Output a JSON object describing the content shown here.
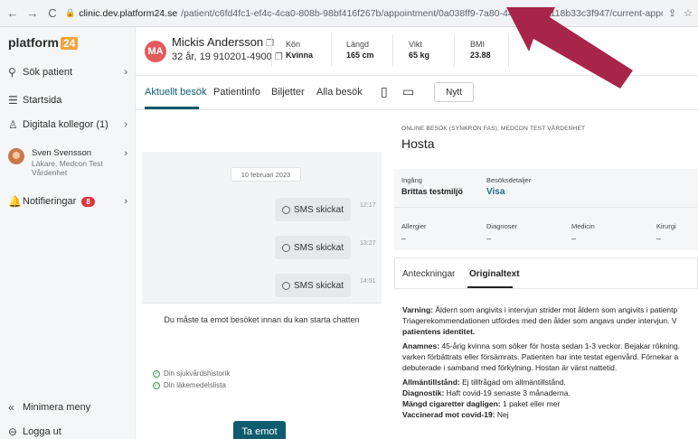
{
  "browser": {
    "back": "←",
    "forward": "→",
    "reload": "C",
    "url_host": "clinic.dev.platform24.se",
    "url_path": "/patient/c6fd4fc1-ef4c-4ca0-808b-98bf416f267b/appointment/0a038ff9-7a80-44cc-93a1-118b33c3f947/current-appointm..."
  },
  "sidebar": {
    "logo_text": "platform",
    "logo_num": "24",
    "items": [
      {
        "label": "Sök patient",
        "icon": "search-icon"
      },
      {
        "label": "Startsida",
        "icon": "list-icon"
      },
      {
        "label": "Digitala kollegor (1)",
        "icon": "people-icon"
      },
      {
        "label": "Notifieringar",
        "icon": "bell-icon",
        "badge": "8"
      }
    ],
    "user": {
      "name": "Sven Svensson",
      "role": "Läkare, Medcon Test Vårdenhet"
    },
    "minimize": "Minimera meny",
    "logout": "Logga ut"
  },
  "patient": {
    "initials": "MA",
    "name": "Mickis Andersson",
    "details": "32 år, 19 910201-4900",
    "stats": [
      {
        "label": "Kön",
        "value": "Kvinna"
      },
      {
        "label": "Längd",
        "value": "165 cm"
      },
      {
        "label": "Vikt",
        "value": "65 kg"
      },
      {
        "label": "BMI",
        "value": "23.88"
      }
    ]
  },
  "tabs": {
    "items": [
      "Aktuellt besök",
      "Patientinfo",
      "Biljetter",
      "Alla besök"
    ],
    "active": "Aktuellt besök",
    "new_button": "Nytt"
  },
  "chat": {
    "date": "10 februari 2023",
    "messages": [
      {
        "text": "SMS skickat",
        "time": "12:17"
      },
      {
        "text": "SMS skickat",
        "time": "13:27"
      },
      {
        "text": "SMS skickat",
        "time": "14:51"
      }
    ],
    "notice": "Du måste ta emot besöket innan du kan starta chatten",
    "checks": [
      "Din sjukvårdshistorik",
      "Din läkemedelslista"
    ],
    "accept_button": "Ta emot"
  },
  "visit": {
    "type": "ONLINE BESÖK (SYNKRON FAS), MEDCON TEST VÅRDENHET",
    "title": "Hosta",
    "ingang_label": "Ingång",
    "ingang_value": "Brittas testmiljö",
    "details_label": "Besöksdetaljer",
    "details_link": "Visa",
    "columns": [
      {
        "label": "Allergier",
        "value": "–"
      },
      {
        "label": "Diagnoser",
        "value": "–"
      },
      {
        "label": "Medicin",
        "value": "–"
      },
      {
        "label": "Kirurgi",
        "value": "–"
      }
    ],
    "note_tabs": [
      "Anteckningar",
      "Originaltext"
    ],
    "note_active": "Originaltext",
    "note_lines": [
      {
        "bold": "Varning:",
        "text": " Åldern som angivits i intervjun strider mot åldern som angivits i patientp"
      },
      {
        "bold": "",
        "text": "Triagerekommendationen utfördes med den ålder som angavs under intervjun. V"
      },
      {
        "bold": "patientens identitet.",
        "text": ""
      },
      {
        "bold": "Anamnes:",
        "text": " 45-årig kvinna som söker för hosta sedan 1-3 veckor. Bejakar rökning. "
      },
      {
        "bold": "",
        "text": "varken förbättrats eller försämrats. Patienten har inte testat egenvård. Förnekar a"
      },
      {
        "bold": "",
        "text": "debuterade i samband med förkylning. Hostan är värst nattetid."
      },
      {
        "bold": "Allmäntillstånd:",
        "text": " Ej tillfrågad om allmäntillstånd."
      },
      {
        "bold": "Diagnostik:",
        "text": " Haft covid-19 senaste 3 månaderna."
      },
      {
        "bold": "Mängd cigaretter dagligen:",
        "text": " 1 paket eller mer"
      },
      {
        "bold": "Vaccinerad mot covid-19:",
        "text": " Nej"
      }
    ]
  },
  "colors": {
    "brand": "#0f5c6e",
    "arrow": "#a8254a",
    "badge": "#d9363e",
    "logo_accent": "#f4a23c"
  }
}
